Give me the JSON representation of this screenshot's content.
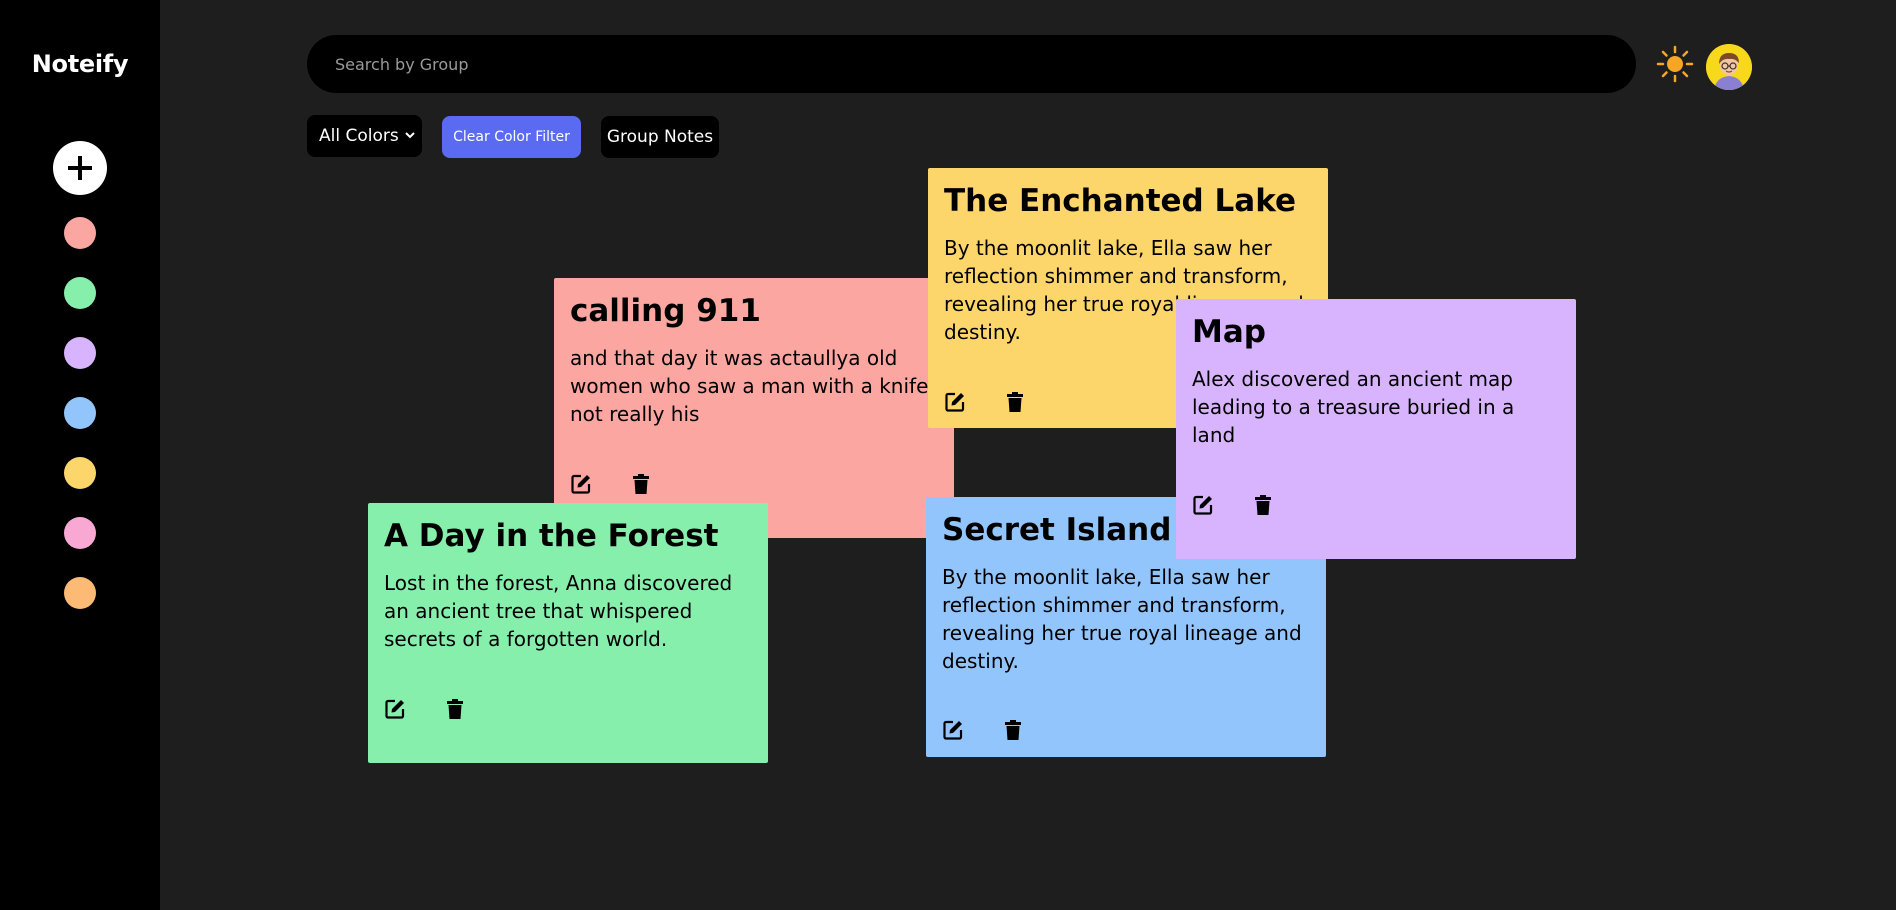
{
  "app": {
    "title": "Noteify"
  },
  "sidebar": {
    "add_icon": "plus-icon",
    "colors": [
      "#fba6a1",
      "#86efac",
      "#d8b4fe",
      "#93c5fd",
      "#fdd66b",
      "#f9a8d4",
      "#fdba74"
    ]
  },
  "search": {
    "placeholder": "Search by Group",
    "value": ""
  },
  "theme_icon": "sun-icon",
  "avatar_icon": "user-avatar",
  "filters": {
    "color_select": "All Colors",
    "clear_label": "Clear Color Filter",
    "group_label": "Group Notes"
  },
  "notes": [
    {
      "title": "calling 911",
      "body": "and that day it was actaullya old women who saw a man with a knife not really his",
      "color": "#fba6a1"
    },
    {
      "title": "The Enchanted Lake",
      "body": "By the moonlit lake, Ella saw her reflection shimmer and transform, revealing her true royal lineage and destiny.",
      "color": "#fdd66b"
    },
    {
      "title": "Map",
      "body": "Alex discovered an ancient map leading to a treasure buried in a land",
      "color": "#d8b4fe"
    },
    {
      "title": "A Day in the Forest",
      "body": "Lost in the forest, Anna discovered an ancient tree that whispered secrets of a forgotten world.",
      "color": "#86efac"
    },
    {
      "title": "Secret Island",
      "body": "By the moonlit lake, Ella saw her reflection shimmer and transform, revealing her true royal lineage and destiny.",
      "color": "#93c5fd"
    }
  ]
}
